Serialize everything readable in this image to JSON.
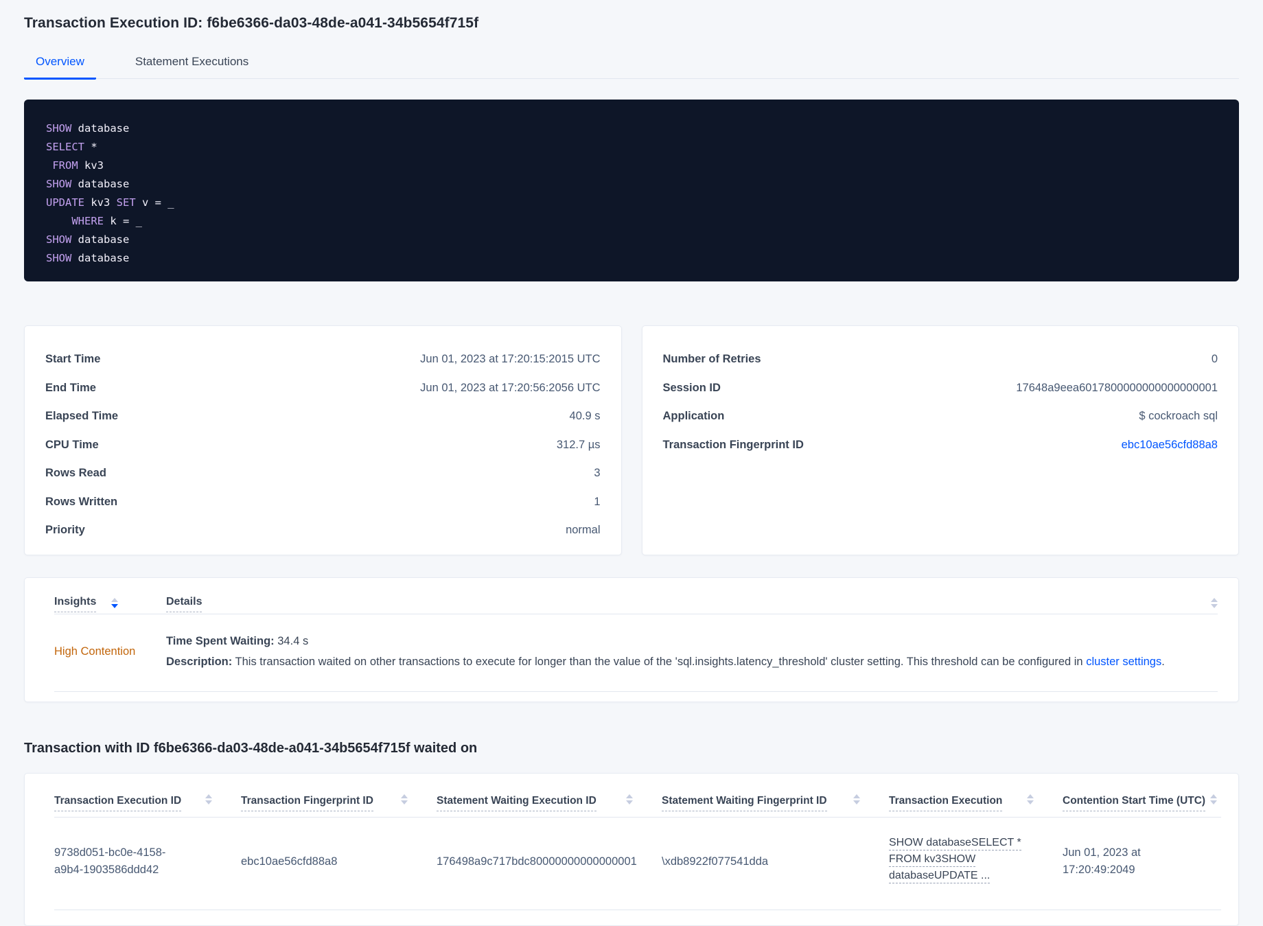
{
  "page": {
    "title": "Transaction Execution ID: f6be6366-da03-48de-a041-34b5654f715f"
  },
  "tabs": [
    {
      "label": "Overview",
      "active": true
    },
    {
      "label": "Statement Executions",
      "active": false
    }
  ],
  "sql": {
    "lines": [
      [
        {
          "t": "SHOW "
        },
        {
          "t": "database"
        }
      ],
      [
        {
          "t": "SELECT "
        },
        {
          "t": "*"
        }
      ],
      [
        {
          "t": " "
        },
        {
          "t": "FROM "
        },
        {
          "t": "kv3"
        }
      ],
      [
        {
          "t": "SHOW "
        },
        {
          "t": "database"
        }
      ],
      [
        {
          "t": "UPDATE "
        },
        {
          "t": "kv3 "
        },
        {
          "t": "SET "
        },
        {
          "t": "v = _"
        }
      ],
      [
        {
          "t": "    "
        },
        {
          "t": "WHERE "
        },
        {
          "t": "k = _"
        }
      ],
      [
        {
          "t": "SHOW "
        },
        {
          "t": "database"
        }
      ],
      [
        {
          "t": "SHOW "
        },
        {
          "t": "database"
        }
      ]
    ]
  },
  "summary_left": {
    "rows": [
      {
        "label": "Start Time",
        "value": "Jun 01, 2023 at 17:20:15:2015 UTC"
      },
      {
        "label": "End Time",
        "value": "Jun 01, 2023 at 17:20:56:2056 UTC"
      },
      {
        "label": "Elapsed Time",
        "value": "40.9 s"
      },
      {
        "label": "CPU Time",
        "value": "312.7 µs"
      },
      {
        "label": "Rows Read",
        "value": "3"
      },
      {
        "label": "Rows Written",
        "value": "1"
      },
      {
        "label": "Priority",
        "value": "normal"
      }
    ]
  },
  "summary_right": {
    "rows": [
      {
        "label": "Number of Retries",
        "value": "0"
      },
      {
        "label": "Session ID",
        "value": "17648a9eea6017800000000000000001"
      },
      {
        "label": "Application",
        "value": "$ cockroach sql"
      },
      {
        "label": "Transaction Fingerprint ID",
        "value": "ebc10ae56cfd88a8"
      }
    ]
  },
  "insights": {
    "columns": {
      "insight": "Insights",
      "details": "Details"
    },
    "row": {
      "insight": "High Contention",
      "waiting_label": "Time Spent Waiting:",
      "waiting_value": " 34.4 s",
      "description_label": "Description:",
      "description_text": " This transaction waited on other transactions to execute for longer than the value of the 'sql.insights.latency_threshold' cluster setting. This threshold can be configured in ",
      "description_link": "cluster settings",
      "description_suffix": "."
    }
  },
  "waited_on": {
    "title": "Transaction with ID f6be6366-da03-48de-a041-34b5654f715f waited on",
    "columns": [
      "Transaction Execution ID",
      "Transaction Fingerprint ID",
      "Statement Waiting Execution ID",
      "Statement Waiting Fingerprint ID",
      "Transaction Execution",
      "Contention Start Time (UTC)"
    ],
    "row": {
      "transaction_execution_id": "9738d051-bc0e-4158-a9b4-1903586ddd42",
      "transaction_fingerprint_id": "ebc10ae56cfd88a8",
      "statement_waiting_execution_id": "176498a9c717bdc80000000000000001",
      "statement_waiting_fingerprint_id": "\\xdb8922f077541dda",
      "transaction_execution_lines": [
        "SHOW databaseSELECT *",
        "FROM kv3SHOW",
        "databaseUPDATE ..."
      ],
      "contention_start_time": "Jun 01, 2023 at 17:20:49:2049"
    }
  },
  "colors": {
    "accent_blue": "#0055ff",
    "insight_orange": "#c2660c",
    "code_background": "#0e1628",
    "code_keyword": "#c3a1ef",
    "page_background": "#f5f7fa",
    "card_border": "#e7ebf2",
    "heading_text": "#242a35",
    "body_text": "#394455",
    "value_text": "#475872"
  }
}
